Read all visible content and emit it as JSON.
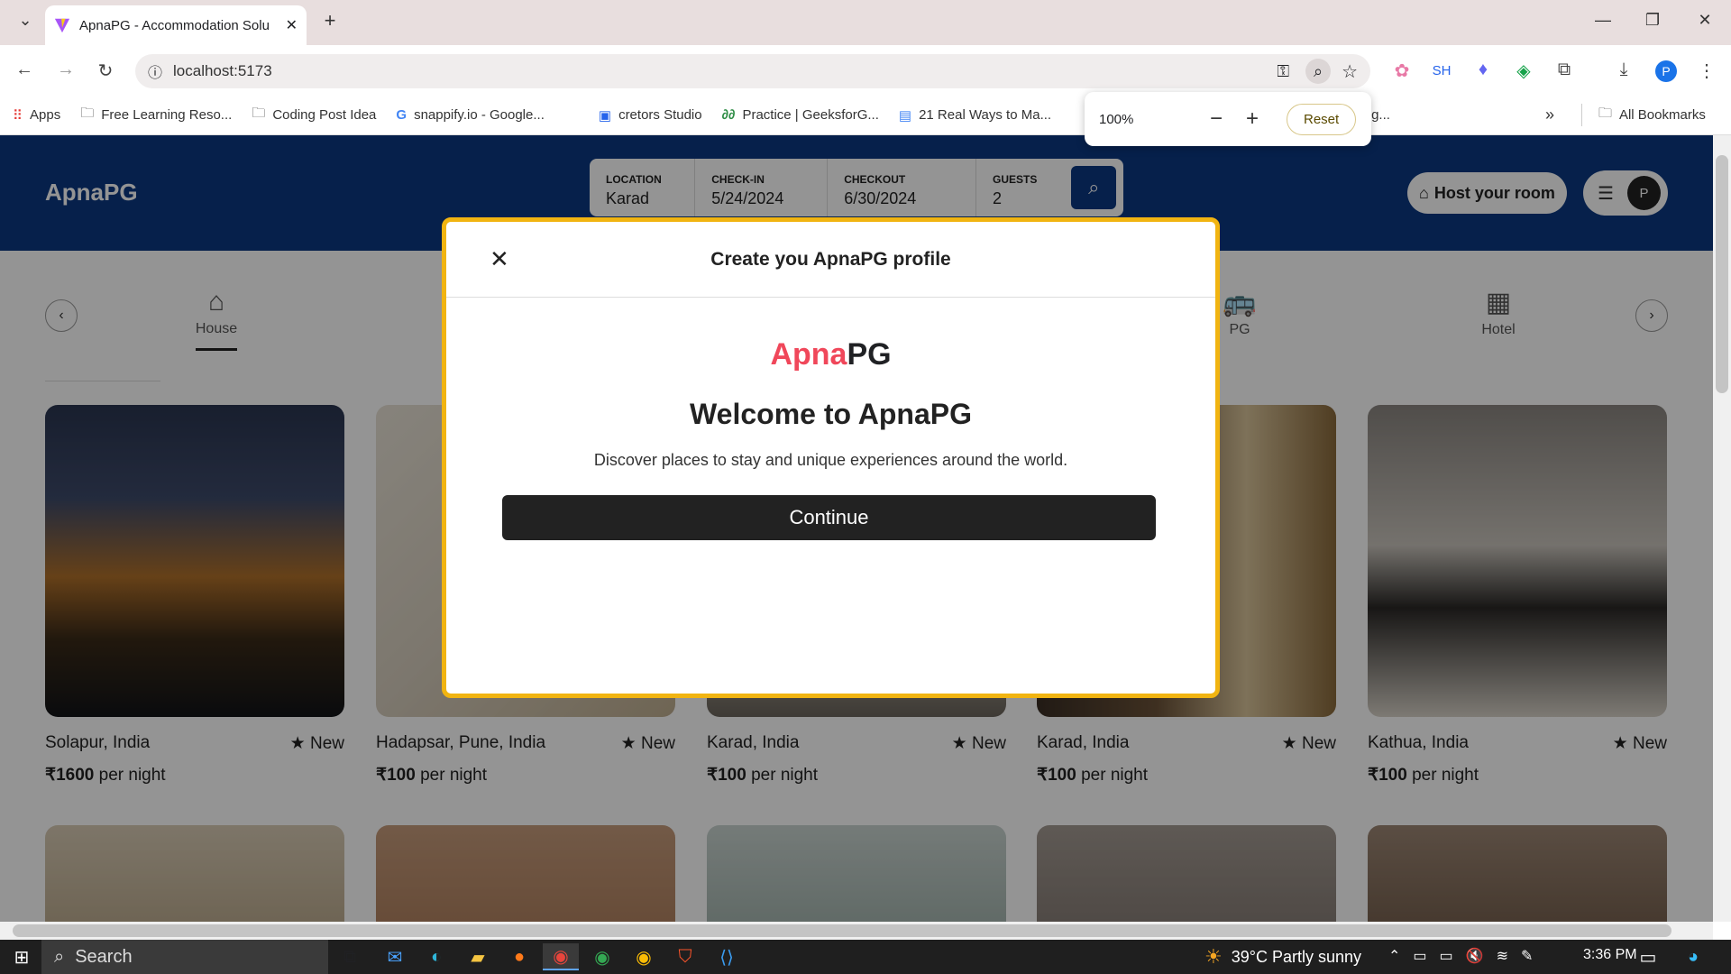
{
  "browser": {
    "tab_title": "ApnaPG - Accommodation Solu",
    "url": "localhost:5173",
    "bookmarks": [
      "Apps",
      "Free Learning Reso...",
      "Coding Post Idea",
      "snappify.io - Google...",
      "cretors Studio",
      "Practice | GeeksforG...",
      "21 Real Ways to Ma...",
      "lleg..."
    ],
    "all_bookmarks": "All Bookmarks",
    "profile_initial": "P",
    "ext_text": "SH",
    "zoom": {
      "percent": "100%",
      "minus": "−",
      "plus": "+",
      "reset": "Reset"
    }
  },
  "app": {
    "brand": "ApnaPG",
    "search": {
      "location_label": "LOCATION",
      "location": "Karad",
      "checkin_label": "CHECK-IN",
      "checkin": "5/24/2024",
      "checkout_label": "CHECKOUT",
      "checkout": "6/30/2024",
      "guests_label": "GUESTS",
      "guests": "2"
    },
    "host_button": "Host your room",
    "avatar_initial": "P",
    "categories": [
      {
        "label": "House",
        "icon": "house-icon"
      },
      {
        "label": "PG",
        "icon": "bus-icon"
      },
      {
        "label": "Hotel",
        "icon": "building-icon"
      }
    ],
    "listings": [
      {
        "location": "Solapur, India",
        "badge": "New",
        "price": "₹1600",
        "suffix": " per night"
      },
      {
        "location": "Hadapsar, Pune, India",
        "badge": "New",
        "price": "₹100",
        "suffix": " per night"
      },
      {
        "location": "Karad, India",
        "badge": "New",
        "price": "₹100",
        "suffix": " per night"
      },
      {
        "location": "Karad, India",
        "badge": "New",
        "price": "₹100",
        "suffix": " per night"
      },
      {
        "location": "Kathua, India",
        "badge": "New",
        "price": "₹100",
        "suffix": " per night"
      }
    ]
  },
  "modal": {
    "title": "Create you ApnaPG profile",
    "logo_a": "Apna",
    "logo_b": "PG",
    "welcome": "Welcome to ApnaPG",
    "description": "Discover places to stay and unique experiences around the world.",
    "continue": "Continue"
  },
  "taskbar": {
    "search": "Search",
    "weather": "39°C  Partly sunny",
    "time": "3:36 PM"
  },
  "colors": {
    "header": "#0c3882",
    "modal_border": "#f1b411",
    "logo_accent": "#f0475a"
  }
}
